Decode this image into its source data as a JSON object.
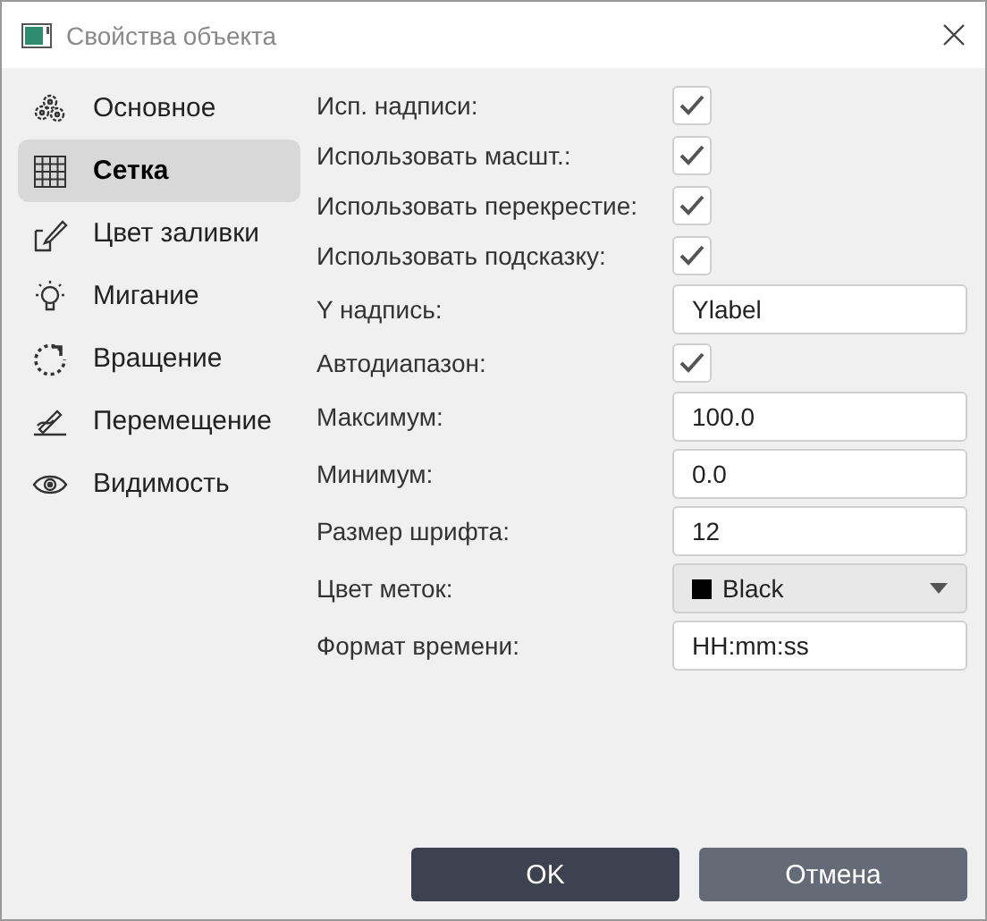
{
  "window": {
    "title": "Свойства объекта"
  },
  "sidebar": {
    "items": [
      {
        "label": "Основное",
        "selected": false
      },
      {
        "label": "Сетка",
        "selected": true
      },
      {
        "label": "Цвет заливки",
        "selected": false
      },
      {
        "label": "Мигание",
        "selected": false
      },
      {
        "label": "Вращение",
        "selected": false
      },
      {
        "label": "Перемещение",
        "selected": false
      },
      {
        "label": "Видимость",
        "selected": false
      }
    ]
  },
  "properties": [
    {
      "kind": "checkbox",
      "label": "Исп. надписи:",
      "checked": true
    },
    {
      "kind": "checkbox",
      "label": "Использовать масшт.:",
      "checked": true
    },
    {
      "kind": "checkbox",
      "label": "Использовать перекрестие:",
      "checked": true
    },
    {
      "kind": "checkbox",
      "label": "Использовать подсказку:",
      "checked": true
    },
    {
      "kind": "text",
      "label": "Y надпись:",
      "value": "Ylabel"
    },
    {
      "kind": "checkbox",
      "label": "Автодиапазон:",
      "checked": true
    },
    {
      "kind": "text",
      "label": "Максимум:",
      "value": "100.0"
    },
    {
      "kind": "text",
      "label": "Минимум:",
      "value": "0.0"
    },
    {
      "kind": "text",
      "label": "Размер шрифта:",
      "value": "12"
    },
    {
      "kind": "select",
      "label": "Цвет меток:",
      "value": "Black",
      "color": "#000000"
    },
    {
      "kind": "text",
      "label": "Формат времени:",
      "value": "HH:mm:ss"
    }
  ],
  "buttons": [
    {
      "label": "OK",
      "kind": "primary"
    },
    {
      "label": "Отмена",
      "kind": "secondary"
    }
  ]
}
